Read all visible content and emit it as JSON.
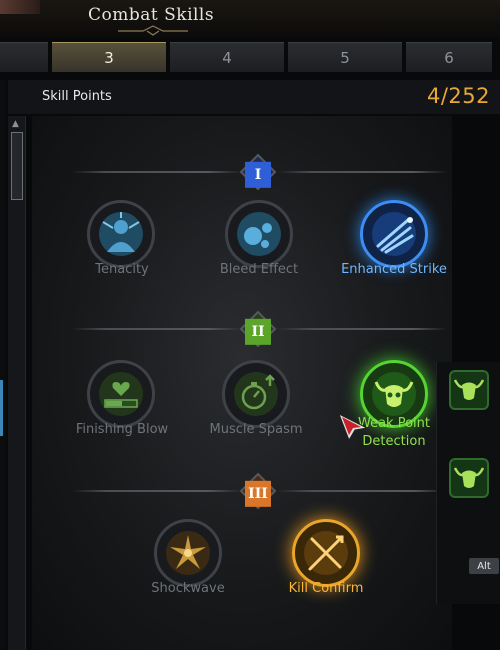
{
  "window": {
    "title": "Combat Skills"
  },
  "tabs": [
    {
      "label": "",
      "active": false
    },
    {
      "label": "3",
      "active": true
    },
    {
      "label": "4",
      "active": false
    },
    {
      "label": "5",
      "active": false
    },
    {
      "label": "6",
      "active": false
    }
  ],
  "skill_points": {
    "label": "Skill Points",
    "value": "4/252"
  },
  "tiers": [
    {
      "numeral": "I",
      "color": "#2f5fd6"
    },
    {
      "numeral": "II",
      "color": "#5aa52a"
    },
    {
      "numeral": "III",
      "color": "#d9762a"
    }
  ],
  "skills": {
    "tenacity": {
      "label": "Tenacity",
      "state": "locked",
      "icon": "figure-icon"
    },
    "bleed_effect": {
      "label": "Bleed Effect",
      "state": "locked",
      "icon": "blood-drip-icon"
    },
    "enhanced_strike": {
      "label": "Enhanced Strike",
      "state": "selected",
      "icon": "slash-icon",
      "label_color": "#6fb8ff"
    },
    "finishing_blow": {
      "label": "Finishing Blow",
      "state": "locked",
      "icon": "heart-bar-icon"
    },
    "muscle_spasm": {
      "label": "Muscle Spasm",
      "state": "locked",
      "icon": "stopwatch-icon"
    },
    "weak_point_detection": {
      "label_line1": "Weak Point",
      "label_line2": "Detection",
      "state": "selected",
      "icon": "bull-skull-icon",
      "label_color": "#92e34a"
    },
    "shockwave": {
      "label": "Shockwave",
      "state": "locked",
      "icon": "burst-icon"
    },
    "kill_confirm": {
      "label": "Kill Confirm",
      "state": "selected",
      "icon": "crossed-arrows-icon",
      "label_color": "#ffb632"
    }
  },
  "side_panel": {
    "key_hint": "Alt"
  }
}
